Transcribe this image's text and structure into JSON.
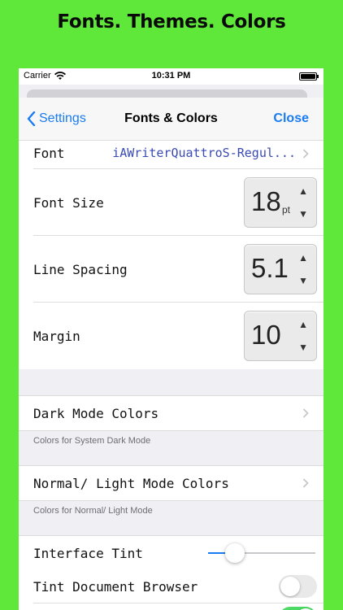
{
  "promo": {
    "title": "Fonts. Themes. Colors"
  },
  "status_bar": {
    "carrier": "Carrier",
    "time": "10:31 PM"
  },
  "nav": {
    "back_label": "Settings",
    "title": "Fonts & Colors",
    "close_label": "Close"
  },
  "font_row": {
    "label": "Font",
    "value": "iAWriterQuattroS-Regul..."
  },
  "steppers": {
    "font_size": {
      "label": "Font Size",
      "value": "18",
      "unit": "pt"
    },
    "line_spacing": {
      "label": "Line Spacing",
      "value": "5.1"
    },
    "margin": {
      "label": "Margin",
      "value": "10"
    }
  },
  "stepper_arrows": {
    "up": "▲",
    "down": "▼"
  },
  "dark_mode": {
    "label": "Dark Mode Colors",
    "footer": "Colors for System Dark Mode"
  },
  "light_mode": {
    "label": "Normal/ Light Mode Colors",
    "footer": "Colors for Normal/ Light Mode"
  },
  "interface_tint": {
    "label": "Interface Tint",
    "value": 0.25
  },
  "tint_browser": {
    "label": "Tint Document Browser",
    "on": false
  },
  "bottom_toggle": {
    "on": true
  },
  "colors": {
    "accent": "#1a7cf2",
    "background": "#5fe83a",
    "switch_on": "#4cd964"
  }
}
